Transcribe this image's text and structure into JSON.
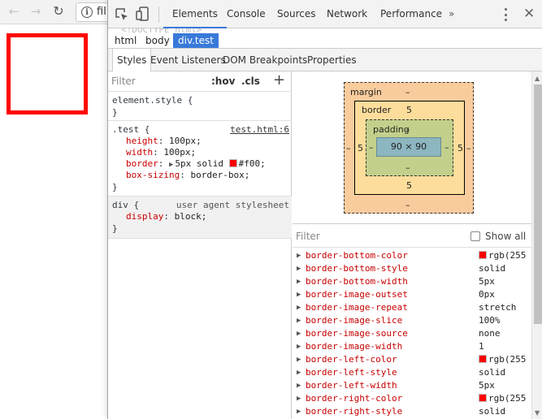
{
  "browser": {
    "url": "fil",
    "icons": {
      "back": "arrow-left-icon",
      "forward": "arrow-right-icon",
      "reload": "reload-icon",
      "info": "info-icon"
    }
  },
  "page": {
    "box_border_color": "#ff0000"
  },
  "devtools": {
    "toolbar": {
      "tabs": [
        "Elements",
        "Console",
        "Sources",
        "Network",
        "Performance"
      ],
      "active_tab": "Elements",
      "more": "»",
      "icons": {
        "inspect": "inspect-element-icon",
        "device": "device-toolbar-icon",
        "menu": "kebab-menu-icon",
        "close": "close-icon"
      }
    },
    "breadcrumb": [
      "html",
      "body",
      "div.test"
    ],
    "subtabs": [
      "Styles",
      "Event Listeners",
      "DOM Breakpoints",
      "Properties"
    ],
    "styles": {
      "filter_placeholder": "Filter",
      "hov": ":hov",
      "cls": ".cls",
      "add": "+",
      "element_style": {
        "selector": "element.style {",
        "close": "}"
      },
      "test_rule": {
        "selector": ".test {",
        "source": "test.html:6",
        "props": [
          {
            "name": "height",
            "value": "100px;"
          },
          {
            "name": "width",
            "value": "100px;"
          },
          {
            "name": "border",
            "value": "5px solid",
            "color_value": "#f00;",
            "swatch": "#ff0000"
          },
          {
            "name": "box-sizing",
            "value": "border-box;"
          }
        ],
        "close": "}"
      },
      "div_rule": {
        "selector": "div {",
        "source": "user agent stylesheet",
        "props": [
          {
            "name": "display",
            "value": "block;"
          }
        ],
        "close": "}"
      }
    },
    "box_model": {
      "margin_label": "margin",
      "margin": "–",
      "margin_bottom": "–",
      "border_label": "border",
      "border_top": "5",
      "border_bottom": "5",
      "border_left": "5",
      "border_right": "5",
      "margin_left": "–",
      "margin_right": "–",
      "padding_label": "padding",
      "padding_top": "–",
      "padding_bottom": "–",
      "padding_left": "–",
      "padding_right": "–",
      "content": "90 × 90",
      "colors": {
        "margin": "#f9cc9d",
        "border": "#fddd9b",
        "padding": "#c3d08b",
        "content": "#8cb6c0"
      }
    },
    "computed": {
      "filter_placeholder": "Filter",
      "show_all": "Show all",
      "properties": [
        {
          "name": "border-bottom-color",
          "value": "rgb(255",
          "swatch": true
        },
        {
          "name": "border-bottom-style",
          "value": "solid"
        },
        {
          "name": "border-bottom-width",
          "value": "5px"
        },
        {
          "name": "border-image-outset",
          "value": "0px"
        },
        {
          "name": "border-image-repeat",
          "value": "stretch"
        },
        {
          "name": "border-image-slice",
          "value": "100%"
        },
        {
          "name": "border-image-source",
          "value": "none"
        },
        {
          "name": "border-image-width",
          "value": "1"
        },
        {
          "name": "border-left-color",
          "value": "rgb(255",
          "swatch": true
        },
        {
          "name": "border-left-style",
          "value": "solid"
        },
        {
          "name": "border-left-width",
          "value": "5px"
        },
        {
          "name": "border-right-color",
          "value": "rgb(255",
          "swatch": true
        },
        {
          "name": "border-right-style",
          "value": "solid"
        }
      ]
    }
  }
}
